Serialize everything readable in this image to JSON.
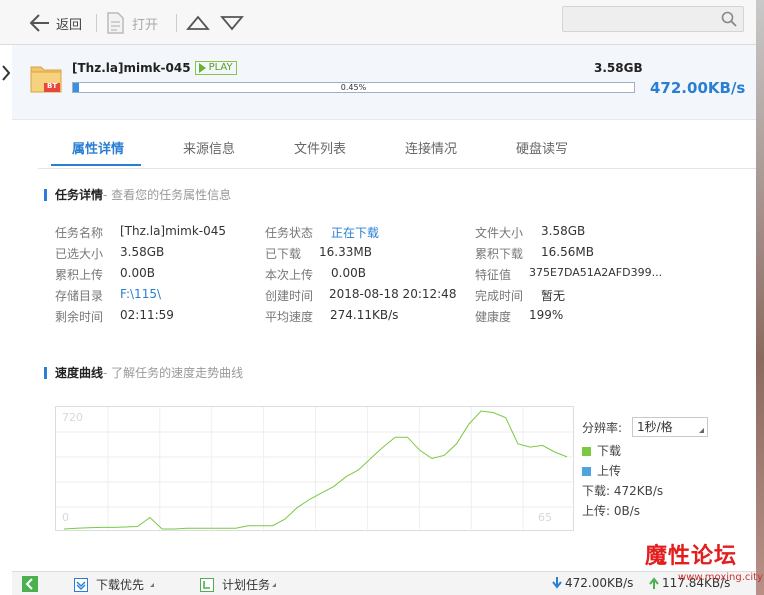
{
  "toolbar": {
    "back_label": "返回",
    "open_label": "打开"
  },
  "task": {
    "badge": "BT",
    "name": "[Thz.la]mimk-045",
    "play_label": "PLAY",
    "size": "3.58GB",
    "progress_text": "0.45%",
    "progress": 0.45,
    "speed": "472.00KB/s"
  },
  "tabs": [
    "属性详情",
    "来源信息",
    "文件列表",
    "连接情况",
    "硬盘读写"
  ],
  "details": {
    "title": "任务详情",
    "subtitle": " - 查看您的任务属性信息",
    "fields": [
      {
        "label": "任务名称",
        "value": "[Thz.la]mimk-045"
      },
      {
        "label": "已选大小",
        "value": "3.58GB"
      },
      {
        "label": "累积上传",
        "value": "0.00B"
      },
      {
        "label": "存储目录",
        "value": "F:\\115\\"
      },
      {
        "label": "剩余时间",
        "value": "02:11:59"
      },
      {
        "label": "任务状态",
        "value": "正在下载"
      },
      {
        "label": "已下载",
        "value": "16.33MB"
      },
      {
        "label": "本次上传",
        "value": "0.00B"
      },
      {
        "label": "创建时间",
        "value": "2018-08-18 20:12:48"
      },
      {
        "label": "平均速度",
        "value": "274.11KB/s"
      },
      {
        "label": "文件大小",
        "value": "3.58GB"
      },
      {
        "label": "累积下载",
        "value": "16.56MB"
      },
      {
        "label": "特征值",
        "value": "375E7DA51A2AFD399..."
      },
      {
        "label": "完成时间",
        "value": "暂无"
      },
      {
        "label": "健康度",
        "value": "199%"
      }
    ]
  },
  "speed": {
    "title": "速度曲线",
    "subtitle": " - 了解任务的速度走势曲线",
    "resolution_label": "分辨率:",
    "resolution_value": "1秒/格",
    "legend_download": "下载",
    "legend_upload": "上传",
    "download_text": "下载:  472KB/s",
    "upload_text": "上传:  0B/s",
    "colors": {
      "download": "#7ac943",
      "upload": "#4fa3e0"
    }
  },
  "chart_data": {
    "type": "line",
    "y_max_label": "720",
    "y_min_label": "0",
    "x_label_right": "65",
    "ylim": [
      0,
      720
    ],
    "series": [
      {
        "name": "下载",
        "values": [
          0,
          5,
          8,
          10,
          10,
          12,
          15,
          70,
          0,
          0,
          5,
          5,
          5,
          5,
          5,
          20,
          20,
          20,
          60,
          130,
          180,
          220,
          260,
          320,
          360,
          430,
          500,
          560,
          560,
          480,
          430,
          450,
          520,
          640,
          720,
          710,
          680,
          520,
          500,
          510,
          470,
          440
        ]
      }
    ]
  },
  "statusbar": {
    "priority_label": "下载优先",
    "plan_label": "计划任务",
    "download_speed": "472.00KB/s",
    "upload_speed": "117.84KB/s"
  },
  "watermark": {
    "text": "魔性论坛",
    "url": "www.moxing.city"
  }
}
